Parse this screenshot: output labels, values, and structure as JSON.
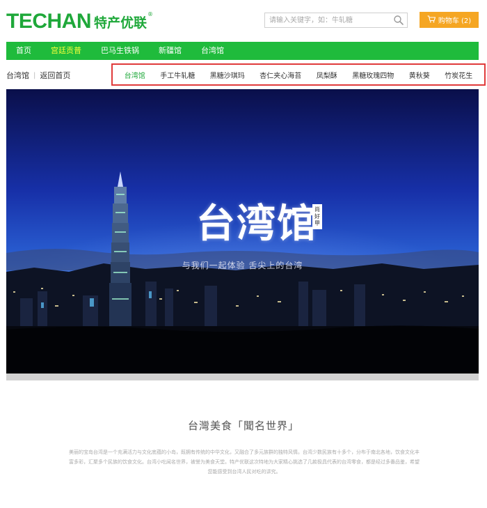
{
  "header": {
    "logo_latin": "TECHAN",
    "logo_cn": "特产优联",
    "logo_reg": "®",
    "search_placeholder": "请输入关键字，如：牛轧糖",
    "cart_label": "购物车 (2)"
  },
  "nav": {
    "items": [
      {
        "label": "首页",
        "active": false
      },
      {
        "label": "宫廷贡普",
        "active": true
      },
      {
        "label": "巴马生铁锅",
        "active": false
      },
      {
        "label": "新疆馆",
        "active": false
      },
      {
        "label": "台湾馆",
        "active": false
      }
    ]
  },
  "breadcrumb": {
    "current": "台湾馆",
    "separator": "|",
    "back_link": "返回首页"
  },
  "subnav": {
    "items": [
      {
        "label": "台湾馆",
        "active": true
      },
      {
        "label": "手工牛轧糖",
        "active": false
      },
      {
        "label": "黑糖沙琪玛",
        "active": false
      },
      {
        "label": "杏仁夹心海苔",
        "active": false
      },
      {
        "label": "凤梨酥",
        "active": false
      },
      {
        "label": "黑糖玫瑰四物",
        "active": false
      },
      {
        "label": "黄秋葵",
        "active": false
      },
      {
        "label": "竹炭花生",
        "active": false
      }
    ]
  },
  "banner": {
    "title": "台湾馆",
    "seal": "尚好甲",
    "slogan": "与我们一起体验 舌尖上的台湾"
  },
  "intro": {
    "title": "台灣美食「聞名世界」",
    "text": "美丽的宝岛台湾是一个充满活力与文化底蕴的小岛，既拥有传统的中华文化，又融合了多元族群的独特风情。台湾少数民族有十多个，分布于南北各地，饮食文化丰富多彩，汇聚多个民族的饮食文化。台湾小吃闻名世界，被誉为美食天堂。特产优联这次特地为大家精心挑选了几款极具代表的台湾零食，都是经过多番品鉴，希望您能感受到台湾人民对吃的讲究。"
  },
  "colors": {
    "brand_green": "#1fa83a",
    "nav_green": "#1fbb3c",
    "nav_active": "#f6ff3a",
    "cart_orange": "#f5a623",
    "highlight_red": "#e03a3a"
  }
}
